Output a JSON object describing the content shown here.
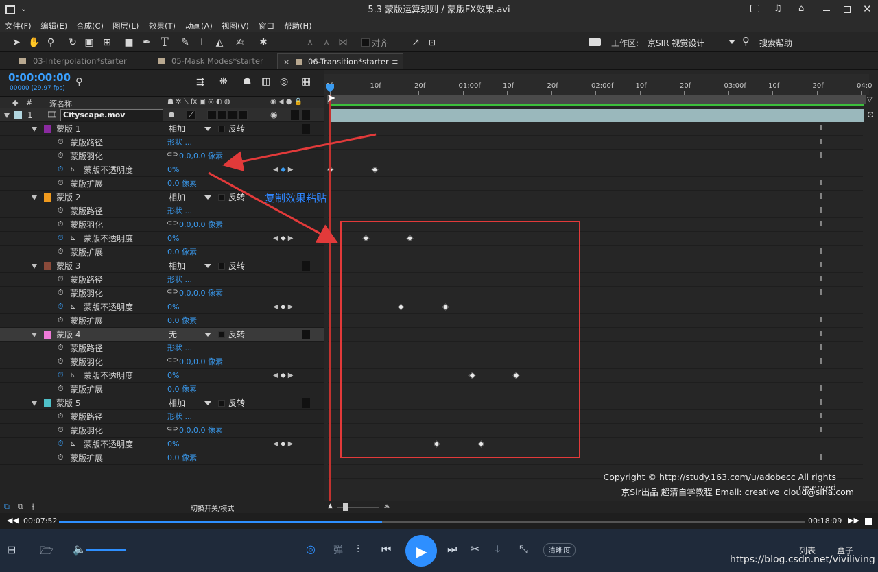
{
  "window": {
    "title": "5.3 蒙版运算规则 / 蒙版FX效果.avi"
  },
  "menu": [
    "文件(F)",
    "编辑(E)",
    "合成(C)",
    "图层(L)",
    "效果(T)",
    "动画(A)",
    "视图(V)",
    "窗口",
    "帮助(H)"
  ],
  "toolbar": {
    "align_label": "对齐",
    "workspace_label": "工作区:",
    "workspace_value": "京SIR 视觉设计",
    "search_label": "搜索帮助"
  },
  "tabs": [
    {
      "label": "03-Interpolation*starter"
    },
    {
      "label": "05-Mask Modes*starter"
    },
    {
      "label": "06-Transition*starter",
      "active": true
    }
  ],
  "timeline": {
    "timecode": "0:00:00:00",
    "fps": "00000 (29.97 fps)",
    "col_num": "#",
    "col_source": "源名称",
    "ruler_labels": [
      "0f",
      "10f",
      "20f",
      "01:00f",
      "10f",
      "20f",
      "02:00f",
      "10f",
      "20f",
      "03:00f",
      "10f",
      "20f",
      "04:0"
    ],
    "layer": {
      "index": "1",
      "name": "Cityscape.mov"
    },
    "toggle_label": "切换开关/模式"
  },
  "masks": [
    {
      "name": "蒙版 1",
      "color": "#8a2aa0",
      "mode": "相加",
      "invert": "反转"
    },
    {
      "name": "蒙版 2",
      "color": "#f09a1e",
      "mode": "相加",
      "invert": "反转"
    },
    {
      "name": "蒙版 3",
      "color": "#8a4a3a",
      "mode": "相加",
      "invert": "反转"
    },
    {
      "name": "蒙版 4",
      "color": "#ef7ad8",
      "mode": "无",
      "invert": "反转"
    },
    {
      "name": "蒙版 5",
      "color": "#4fc0c8",
      "mode": "相加",
      "invert": "反转"
    }
  ],
  "props": {
    "path": "蒙版路径",
    "path_val": "形状 ...",
    "feather": "蒙版羽化",
    "feather_val": "0.0,0.0 像素",
    "opacity": "蒙版不透明度",
    "opacity_val": "0%",
    "expansion": "蒙版扩展",
    "expansion_val": "0.0 像素"
  },
  "annotation": "复制效果粘贴",
  "copyright": {
    "line1": "Copyright © http://study.163.com/u/adobecc All rights reserved",
    "line2": "京Sir出品 超清自学教程 Email: creative_cloud@sina.com"
  },
  "player": {
    "elapsed": "00:07:52",
    "total": "00:18:09",
    "progress": 0.433,
    "danmu": "弹",
    "quality": "清晰度",
    "list": "列表",
    "box": "盒子",
    "watermark": "https://blog.csdn.net/viviliving"
  }
}
